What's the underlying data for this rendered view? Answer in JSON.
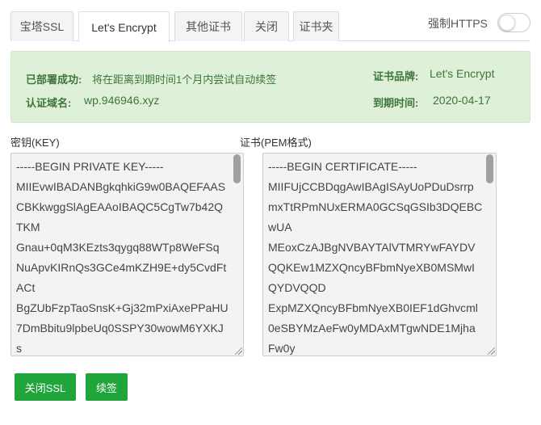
{
  "tabs": [
    {
      "label": "宝塔SSL",
      "active": false
    },
    {
      "label": "Let's Encrypt",
      "active": true
    },
    {
      "label": "其他证书",
      "active": false
    },
    {
      "label": "关闭",
      "active": false
    },
    {
      "label": "证书夹",
      "active": false
    }
  ],
  "https_toggle": {
    "label": "强制HTTPS",
    "on": false
  },
  "info": {
    "status_key": "已部署成功:",
    "status_value": "将在距离到期时间1个月内尝试自动续签",
    "domain_key": "认证域名:",
    "domain_value": "wp.946946.xyz",
    "brand_key": "证书品牌:",
    "brand_value": "Let's Encrypt",
    "expire_key": "到期时间:",
    "expire_value": "2020-04-17"
  },
  "key_field": {
    "label": "密钥(KEY)",
    "value": "-----BEGIN PRIVATE KEY-----\nMIIEvwIBADANBgkqhkiG9w0BAQEFAAS\nCBKkwggSlAgEAAoIBAQC5CgTw7b42Q\nTKM\nGnau+0qM3KEzts3qygq88WTp8WeFSq\nNuApvKIRnQs3GCe4mKZH9E+dy5CvdFt\nACt\nBgZUbFzpTaoSnsK+Gj32mPxiAxePPaHU\n7DmBbitu9lpbeUq0SSPY30wowM6YXKJ\ns"
  },
  "cert_field": {
    "label": "证书(PEM格式)",
    "value": "-----BEGIN CERTIFICATE-----\nMIIFUjCCBDqgAwIBAgISAyUoPDuDsrrp\nmxTtRPmNUxERMA0GCSqGSIb3DQEBC\nwUA\nMEoxCzAJBgNVBAYTAlVTMRYwFAYDV\nQQKEw1MZXQncyBFbmNyeXB0MSMwI\nQYDVQQD\nExpMZXQncyBFbmNyeXB0IEF1dGhvcml\n0eSBYMzAeFw0yMDAxMTgwNDE1Mjha\nFw0y"
  },
  "buttons": {
    "close_ssl": "关闭SSL",
    "renew": "续签"
  }
}
